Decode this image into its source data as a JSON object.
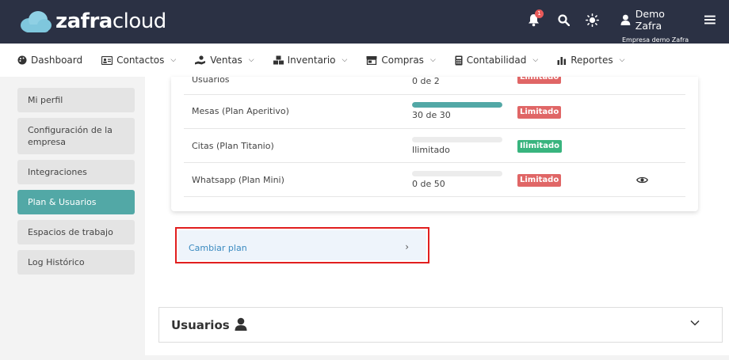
{
  "brand": {
    "logo_bold": "zafra",
    "logo_light": "cloud"
  },
  "header": {
    "notifications_count": "1",
    "user_name": "Demo Zafra",
    "company": "Empresa demo Zafra"
  },
  "nav": [
    {
      "label": "Dashboard",
      "icon": "palette-icon",
      "dropdown": false
    },
    {
      "label": "Contactos",
      "icon": "address-card-icon",
      "dropdown": true
    },
    {
      "label": "Ventas",
      "icon": "hand-holding-dollar-icon",
      "dropdown": true
    },
    {
      "label": "Inventario",
      "icon": "boxes-icon",
      "dropdown": true
    },
    {
      "label": "Compras",
      "icon": "store-icon",
      "dropdown": true
    },
    {
      "label": "Contabilidad",
      "icon": "calculator-icon",
      "dropdown": true
    },
    {
      "label": "Reportes",
      "icon": "bar-chart-icon",
      "dropdown": true
    }
  ],
  "sidebar": {
    "items": [
      {
        "label": "Mi perfil"
      },
      {
        "label": "Configuración de la empresa"
      },
      {
        "label": "Integraciones"
      },
      {
        "label": "Plan & Usuarios",
        "active": true
      },
      {
        "label": "Espacios de trabajo"
      },
      {
        "label": "Log Histórico"
      }
    ]
  },
  "limits": {
    "rows": [
      {
        "label": "Usuarios",
        "count": "0 de 2",
        "progress": 0.0,
        "tag": "Limitado",
        "tag_color": "#e06666"
      },
      {
        "label": "Mesas (Plan Aperitivo)",
        "count": "30 de 30",
        "progress": 1.0,
        "tag": "Limitado",
        "tag_color": "#e06666"
      },
      {
        "label": "Citas (Plan Titanio)",
        "count": "Ilimitado",
        "progress": 0.0,
        "tag": "Ilimitado",
        "tag_color": "#38b47e"
      },
      {
        "label": "Whatsapp (Plan Mini)",
        "count": "0 de 50",
        "progress": 0.0,
        "tag": "Limitado",
        "tag_color": "#e06666",
        "has_eye": true
      }
    ]
  },
  "change_plan": {
    "label": "Cambiar plan",
    "arrow": "›"
  },
  "users_section": {
    "title": "Usuarios"
  },
  "colors": {
    "header_bg": "#2b3144",
    "accent": "#52a8a6",
    "highlight_border": "#e11e1e"
  }
}
